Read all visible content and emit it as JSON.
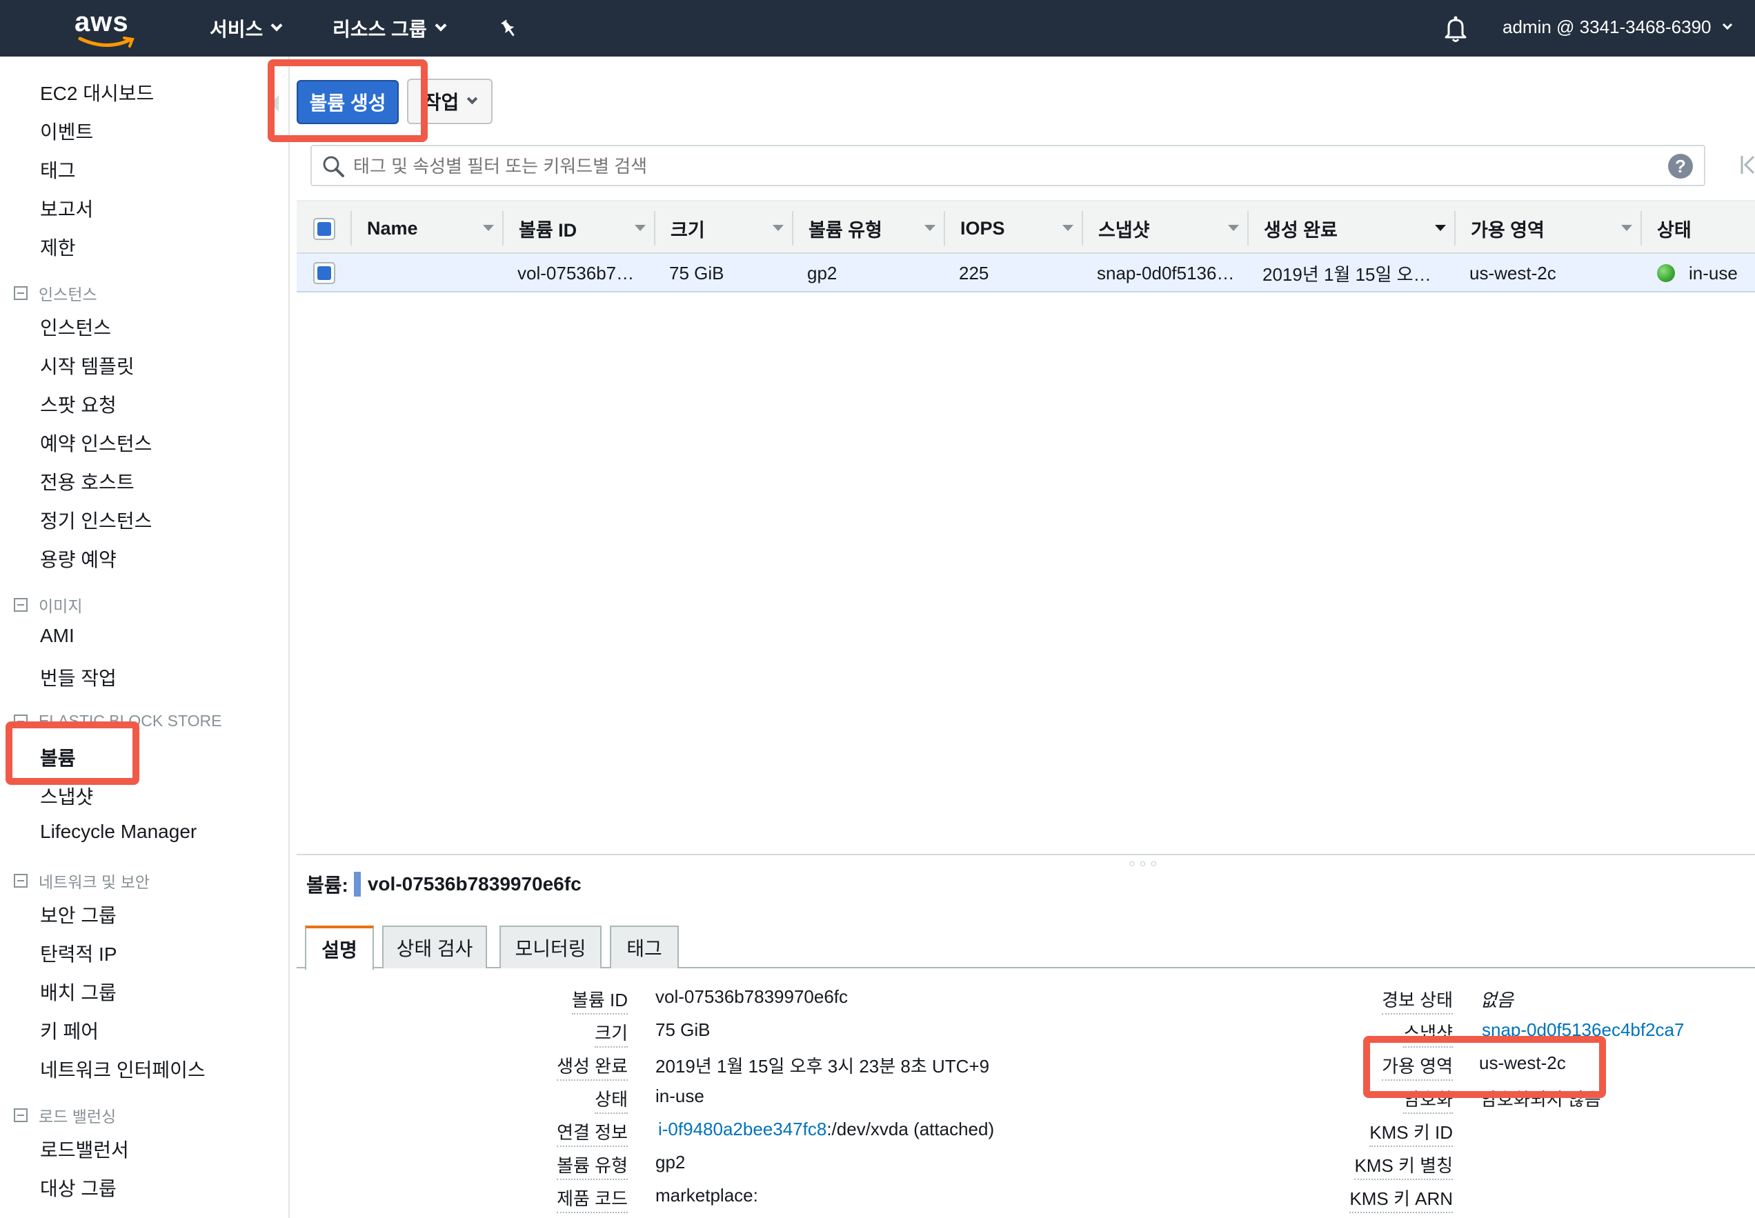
{
  "topnav": {
    "logo_text": "aws",
    "services_label": "서비스",
    "resource_groups_label": "리소스 그룹",
    "account_label": "admin @ 3341-3468-6390"
  },
  "sidebar": {
    "top_links": [
      "EC2 대시보드",
      "이벤트",
      "태그",
      "보고서",
      "제한"
    ],
    "sections": [
      {
        "title": "인스턴스",
        "items": [
          "인스턴스",
          "시작 템플릿",
          "스팟 요청",
          "예약 인스턴스",
          "전용 호스트",
          "정기 인스턴스",
          "용량 예약"
        ]
      },
      {
        "title": "이미지",
        "items": [
          "AMI",
          "번들 작업"
        ]
      },
      {
        "title": "ELASTIC BLOCK STORE",
        "items": [
          "볼륨",
          "스냅샷",
          "Lifecycle Manager"
        ]
      },
      {
        "title": "네트워크 및 보안",
        "items": [
          "보안 그룹",
          "탄력적 IP",
          "배치 그룹",
          "키 페어",
          "네트워크 인터페이스"
        ]
      },
      {
        "title": "로드 밸런싱",
        "items": [
          "로드밸런서",
          "대상 그룹"
        ]
      }
    ],
    "active_item": "볼륨"
  },
  "toolbar": {
    "create_volume_label": "볼륨 생성",
    "actions_label": "작업"
  },
  "search": {
    "placeholder": "태그 및 속성별 필터 또는 키워드별 검색",
    "help_glyph": "?"
  },
  "table": {
    "columns": [
      "Name",
      "볼륨 ID",
      "크기",
      "볼륨 유형",
      "IOPS",
      "스냅샷",
      "생성 완료",
      "가용 영역",
      "상태"
    ],
    "rows": [
      {
        "name": "",
        "volume_id": "vol-07536b7…",
        "size": "75 GiB",
        "type": "gp2",
        "iops": "225",
        "snapshot": "snap-0d0f5136…",
        "created": "2019년 1월 15일 오…",
        "az": "us-west-2c",
        "state": "in-use"
      }
    ]
  },
  "detail": {
    "title_prefix": "볼륨:",
    "title_volume": "vol-07536b7839970e6fc",
    "tabs": [
      "설명",
      "상태 검사",
      "모니터링",
      "태그"
    ],
    "left": [
      {
        "label": "볼륨 ID",
        "value": "vol-07536b7839970e6fc"
      },
      {
        "label": "크기",
        "value": "75 GiB"
      },
      {
        "label": "생성 완료",
        "value": "2019년 1월 15일 오후 3시 23분 8초 UTC+9"
      },
      {
        "label": "상태",
        "value": "in-use"
      },
      {
        "label": "연결 정보",
        "value_link": "i-0f9480a2bee347fc8",
        "value_suffix": ":/dev/xvda (attached)"
      },
      {
        "label": "볼륨 유형",
        "value": "gp2"
      },
      {
        "label": "제품 코드",
        "value": "marketplace:"
      }
    ],
    "right": [
      {
        "label": "경보 상태",
        "value": "없음"
      },
      {
        "label": "스냅샷",
        "value": "snap-0d0f5136ec4bf2ca7"
      },
      {
        "label": "가용 영역",
        "value": "us-west-2c"
      },
      {
        "label": "암호화",
        "value": "암호화되지 않음"
      },
      {
        "label": "KMS 키 ID",
        "value": ""
      },
      {
        "label": "KMS 키 별칭",
        "value": ""
      },
      {
        "label": "KMS 키 ARN",
        "value": ""
      }
    ]
  },
  "colors": {
    "nav_bg": "#232f3e",
    "primary_button": "#2c6fd1",
    "highlight_box": "#f05a47",
    "link": "#0073bb",
    "active_tab_accent": "#ec7211",
    "status_ok": "#3aa632"
  }
}
